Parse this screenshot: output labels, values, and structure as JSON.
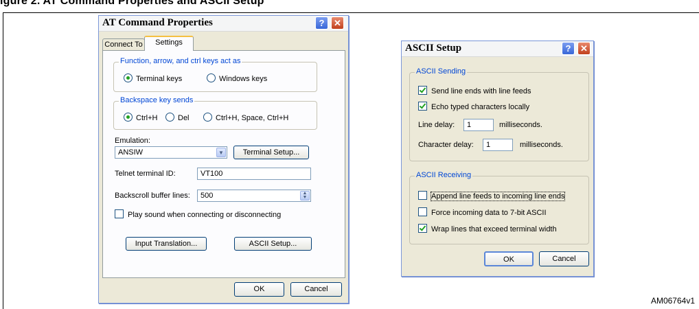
{
  "page": {
    "figure_title": "igure 2.  AT Command Properties and ASCII Setup",
    "figure_id": "AM06764v1"
  },
  "at_dialog": {
    "title": "AT Command Properties",
    "tabs": [
      "Connect To",
      "Settings"
    ],
    "active_tab": "Settings",
    "keys_group": {
      "label": "Function, arrow, and ctrl keys act as",
      "options": [
        {
          "label": "Terminal keys",
          "selected": true
        },
        {
          "label": "Windows keys",
          "selected": false
        }
      ]
    },
    "backspace_group": {
      "label": "Backspace key sends",
      "options": [
        {
          "label": "Ctrl+H",
          "selected": true
        },
        {
          "label": "Del",
          "selected": false
        },
        {
          "label": "Ctrl+H, Space, Ctrl+H",
          "selected": false
        }
      ]
    },
    "emulation": {
      "label": "Emulation:",
      "value": "ANSIW",
      "setup_button": "Terminal Setup..."
    },
    "telnet": {
      "label": "Telnet terminal ID:",
      "value": "VT100"
    },
    "backscroll": {
      "label": "Backscroll buffer lines:",
      "value": "500"
    },
    "play_sound": {
      "label": "Play sound when connecting or disconnecting",
      "checked": false
    },
    "input_translation_button": "Input Translation...",
    "ascii_setup_button": "ASCII Setup...",
    "ok_button": "OK",
    "cancel_button": "Cancel"
  },
  "ascii_dialog": {
    "title": "ASCII Setup",
    "sending": {
      "label": "ASCII Sending",
      "send_line_ends": {
        "label": "Send line ends with line feeds",
        "checked": true
      },
      "echo_typed": {
        "label": "Echo typed characters locally",
        "checked": true
      },
      "line_delay_label": "Line delay:",
      "line_delay_value": "1",
      "line_delay_unit": "milliseconds.",
      "char_delay_label": "Character delay:",
      "char_delay_value": "1",
      "char_delay_unit": "milliseconds."
    },
    "receiving": {
      "label": "ASCII Receiving",
      "append_line_feeds": {
        "label": "Append line feeds to incoming line ends",
        "checked": false
      },
      "force_7bit": {
        "label": "Force incoming data to 7-bit ASCII",
        "checked": false
      },
      "wrap_lines": {
        "label": "Wrap lines that exceed terminal width",
        "checked": true
      }
    },
    "ok_button": "OK",
    "cancel_button": "Cancel"
  }
}
